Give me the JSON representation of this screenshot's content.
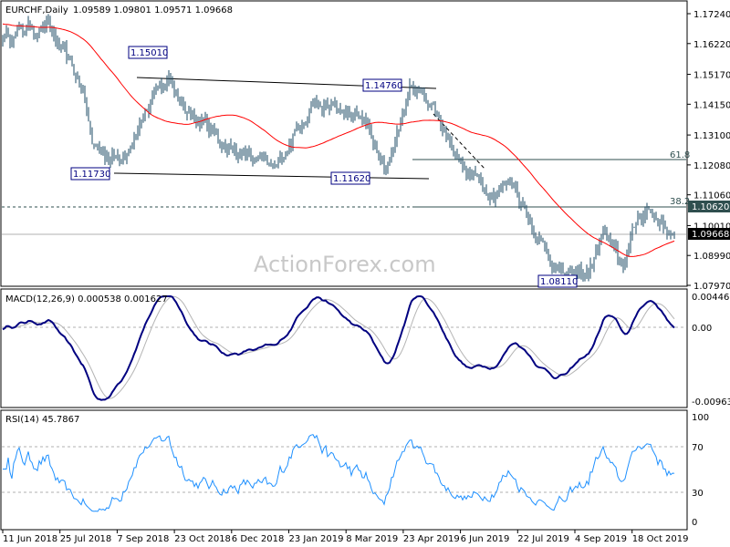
{
  "header": {
    "symbol_tf": "EURCHF,Daily",
    "ohlc": "1.09589 1.09801 1.09571 1.09668"
  },
  "watermark": "ActionForex.com",
  "colors": {
    "bars": "#1c4b66",
    "ma": "#ff0000",
    "macd": "#000080",
    "signal": "#b4b4b4",
    "rsi": "#1e90ff",
    "current_price_bg": "#000000",
    "level_bg": "#2f4f4f"
  },
  "chart_data": [
    {
      "type": "ohlc",
      "title": "EURCHF,Daily",
      "x_tick_labels": [
        "11 Jun 2018",
        "25 Jul 2018",
        "7 Sep 2018",
        "23 Oct 2018",
        "6 Dec 2018",
        "23 Jan 2019",
        "8 Mar 2019",
        "23 Apr 2019",
        "6 Jun 2019",
        "22 Jul 2019",
        "4 Sep 2019",
        "18 Oct 2019"
      ],
      "y_tick_labels": [
        "1.17240",
        "1.16220",
        "1.15170",
        "1.14150",
        "1.13100",
        "1.12080",
        "1.11060",
        "1.10010",
        "1.08990",
        "1.07970"
      ],
      "ylim": [
        1.0797,
        1.1724
      ],
      "last": {
        "open": 1.09589,
        "high": 1.09801,
        "low": 1.09571,
        "close": 1.09668
      },
      "current_price_label": "1.09668",
      "level_label": "1.10620",
      "approx_close_path": [
        {
          "bar": 0,
          "close": 1.1646
        },
        {
          "bar": 24,
          "close": 1.169
        },
        {
          "bar": 44,
          "close": 1.146
        },
        {
          "bar": 49,
          "close": 1.1273
        },
        {
          "bar": 64,
          "close": 1.1226
        },
        {
          "bar": 79,
          "close": 1.14
        },
        {
          "bar": 91,
          "close": 1.1501
        },
        {
          "bar": 104,
          "close": 1.138
        },
        {
          "bar": 124,
          "close": 1.127
        },
        {
          "bar": 149,
          "close": 1.1185
        },
        {
          "bar": 169,
          "close": 1.143
        },
        {
          "bar": 199,
          "close": 1.135
        },
        {
          "bar": 209,
          "close": 1.1175
        },
        {
          "bar": 224,
          "close": 1.1476
        },
        {
          "bar": 234,
          "close": 1.143
        },
        {
          "bar": 254,
          "close": 1.118
        },
        {
          "bar": 269,
          "close": 1.112
        },
        {
          "bar": 279,
          "close": 1.115
        },
        {
          "bar": 299,
          "close": 1.09
        },
        {
          "bar": 309,
          "close": 1.0825
        },
        {
          "bar": 321,
          "close": 1.084
        },
        {
          "bar": 329,
          "close": 1.098
        },
        {
          "bar": 339,
          "close": 1.085
        },
        {
          "bar": 349,
          "close": 1.104
        },
        {
          "bar": 354,
          "close": 1.106
        },
        {
          "bar": 368,
          "close": 1.09668
        }
      ],
      "moving_average": {
        "type": "SMA",
        "period": 55
      },
      "annotations": {
        "labels": [
          "1.15010",
          "1.14760",
          "1.11730",
          "1.11620",
          "1.08110"
        ],
        "fib": [
          "61.8",
          "38.2"
        ]
      }
    },
    {
      "type": "line",
      "title": "MACD(12,26,9) 0.000538 0.001627",
      "series": [
        {
          "name": "MACD",
          "last": 0.000538
        },
        {
          "name": "Signal",
          "last": 0.001627
        }
      ],
      "y_tick_labels": [
        "0.004461",
        "0.00",
        "-0.009633"
      ],
      "ylim": [
        -0.009633,
        0.004461
      ]
    },
    {
      "type": "line",
      "title": "RSI(14) 45.7867",
      "series": [
        {
          "name": "RSI",
          "last": 45.7867
        }
      ],
      "y_tick_labels": [
        "100",
        "70",
        "30",
        "0"
      ],
      "ylim": [
        0,
        100
      ],
      "levels": [
        70,
        30
      ]
    }
  ]
}
